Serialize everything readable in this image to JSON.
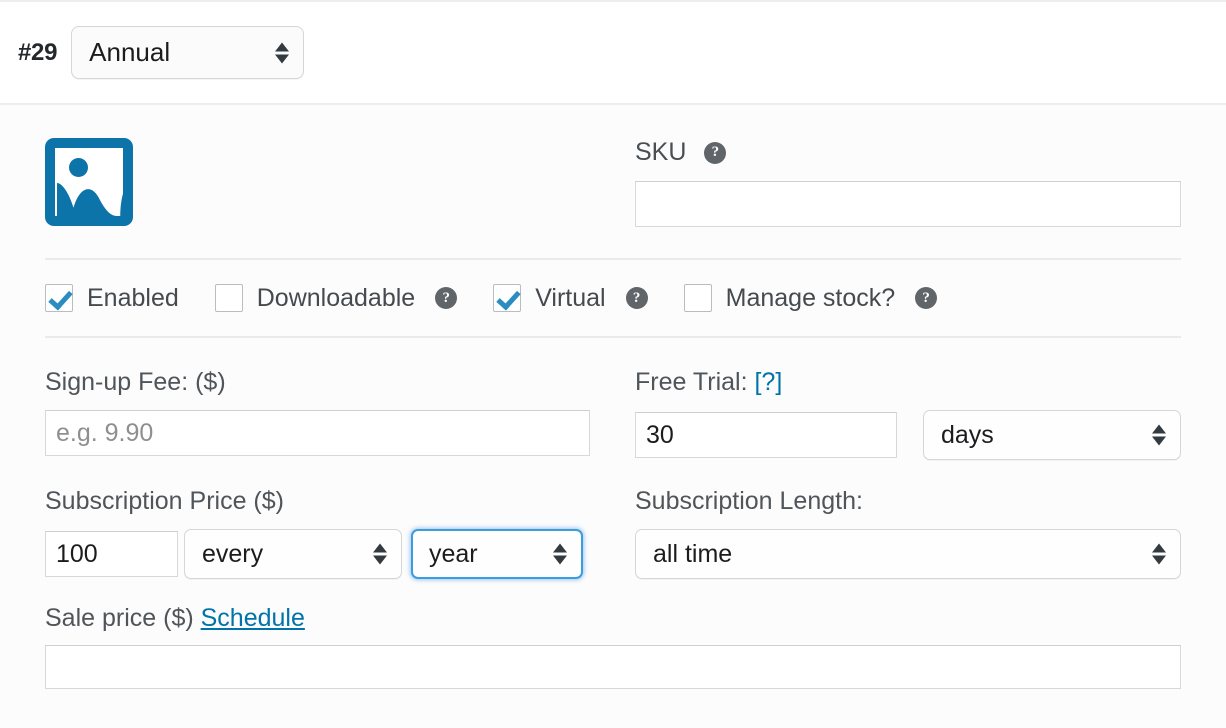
{
  "header": {
    "variation_number": "#29",
    "variation_type": "Annual"
  },
  "media": {
    "image_placeholder_alt": "image-placeholder"
  },
  "sku": {
    "label": "SKU",
    "help": "?",
    "value": "",
    "placeholder": ""
  },
  "checkboxes": [
    {
      "label": "Enabled",
      "checked": true,
      "has_help": false,
      "help": "?"
    },
    {
      "label": "Downloadable",
      "checked": false,
      "has_help": true,
      "help": "?"
    },
    {
      "label": "Virtual",
      "checked": true,
      "has_help": true,
      "help": "?"
    },
    {
      "label": "Manage stock?",
      "checked": false,
      "has_help": true,
      "help": "?"
    }
  ],
  "signup_fee": {
    "label": "Sign-up Fee: ($)",
    "value": "",
    "placeholder": "e.g. 9.90"
  },
  "free_trial": {
    "label_text": "Free Trial:",
    "label_link": "[?]",
    "length_value": "30",
    "period_value": "days"
  },
  "subscription_price": {
    "label": "Subscription Price ($)",
    "price_value": "100",
    "interval_value": "every",
    "period_value": "year"
  },
  "subscription_length": {
    "label": "Subscription Length:",
    "value": "all time"
  },
  "sale_price": {
    "label_text": "Sale price ($)",
    "schedule_link": "Schedule",
    "value": "",
    "placeholder": ""
  },
  "colors": {
    "link": "#0073aa",
    "checkbox_check": "#2b8cc0",
    "image_icon": "#0c74a8",
    "focus_ring": "#3d9cdd",
    "help_bg": "#5f6569"
  }
}
